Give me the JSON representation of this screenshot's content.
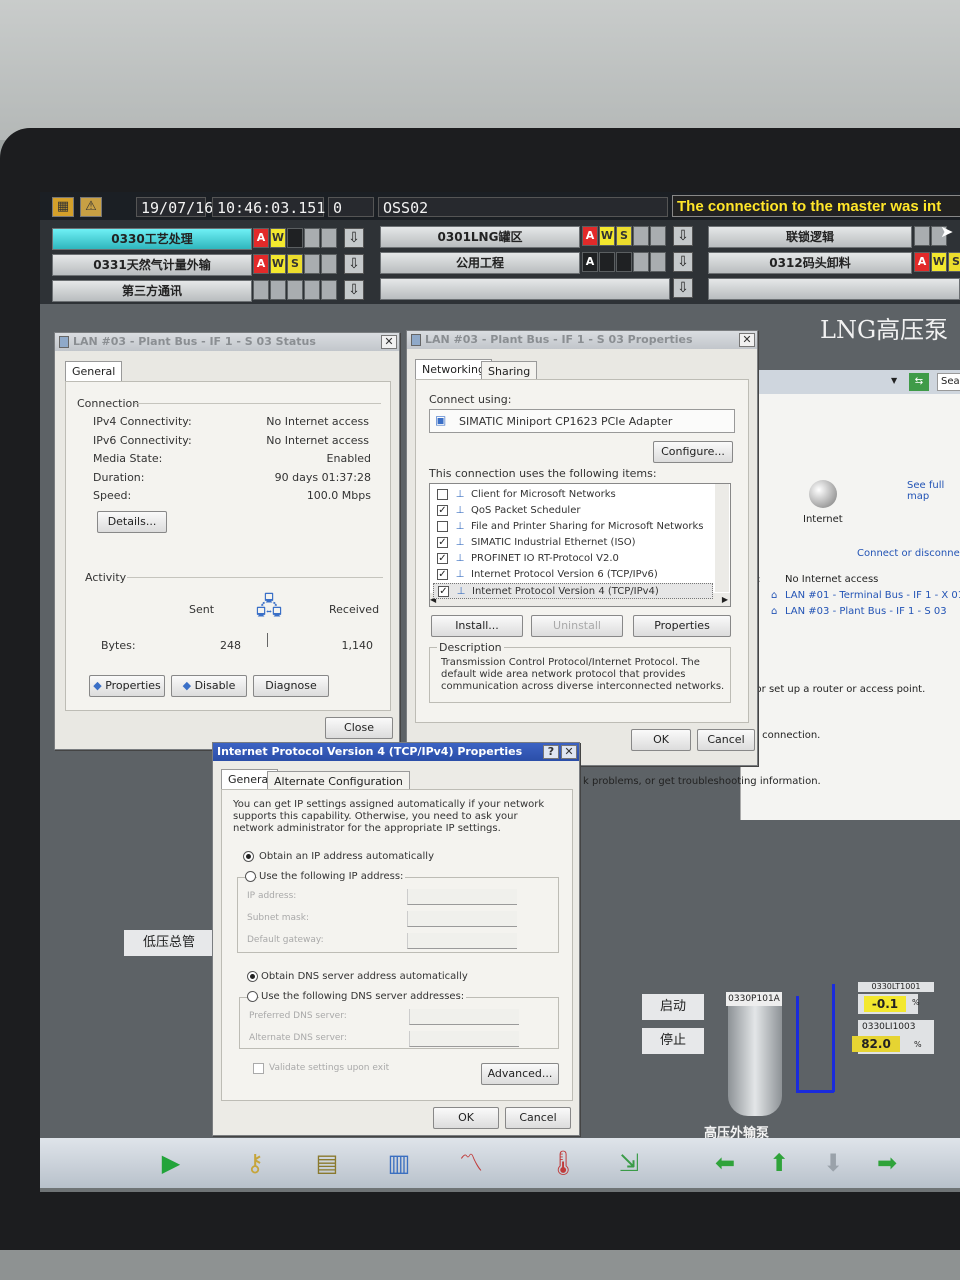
{
  "topbar": {
    "date": "19/07/16",
    "time": "10:46:03.151",
    "alarm_count": "0",
    "station": "OSS02",
    "message": "The connection to the master was int"
  },
  "areas": [
    {
      "label": "0330工艺处理",
      "flags": [
        "A",
        "W",
        "",
        ""
      ]
    },
    {
      "label": "0301LNG罐区",
      "flags": [
        "A",
        "W",
        "S",
        ""
      ]
    },
    {
      "label": "联锁逻辑",
      "flags": [
        "",
        "",
        ""
      ]
    },
    {
      "label": "0331天然气计量外输",
      "flags": [
        "A",
        "W",
        "S",
        ""
      ]
    },
    {
      "label": "公用工程",
      "flags": [
        "A",
        "",
        "",
        ""
      ]
    },
    {
      "label": "0312码头卸料",
      "flags": [
        "A",
        "W",
        "S"
      ]
    },
    {
      "label": "第三方通讯",
      "flags": [
        "",
        "",
        "",
        ""
      ]
    }
  ],
  "background": {
    "heading": "LNG高压泵",
    "search": "Sea",
    "see_full_map": "See full map",
    "internet_label": "Internet",
    "connect_link": "Connect or disconnect",
    "access_type_key": "e:",
    "access_type_value": "No Internet access",
    "connections_key": "s:",
    "conn1": "LAN #01 - Terminal Bus - IF 1 - X 01",
    "conn2": "LAN #03 - Plant Bus - IF 1 - S 03",
    "text_router": "; or set up a router or access point.",
    "text_network": "rk connection.",
    "text_problems": "k problems, or get troubleshooting information.",
    "low_pressure_label": "低压总管",
    "start_button": "启动",
    "stop_button": "停止",
    "pump_tag": "0330P101A",
    "pump_name": "高压外输泵",
    "level_tag1": "0330LT1001",
    "level_value1": "-0.1",
    "level_tag2": "0330LI1003",
    "level_value2": "82.0",
    "unit": "%"
  },
  "status_window": {
    "title": "LAN #03 - Plant Bus - IF 1 - S 03 Status",
    "tab": "General",
    "connection_header": "Connection",
    "rows": [
      {
        "key": "IPv4 Connectivity:",
        "value": "No Internet access"
      },
      {
        "key": "IPv6 Connectivity:",
        "value": "No Internet access"
      },
      {
        "key": "Media State:",
        "value": "Enabled"
      },
      {
        "key": "Duration:",
        "value": "90 days 01:37:28"
      },
      {
        "key": "Speed:",
        "value": "100.0 Mbps"
      }
    ],
    "details_button": "Details...",
    "activity_header": "Activity",
    "sent_label": "Sent",
    "received_label": "Received",
    "bytes_label": "Bytes:",
    "bytes_sent": "248",
    "bytes_received": "1,140",
    "properties_button": "Properties",
    "disable_button": "Disable",
    "diagnose_button": "Diagnose",
    "close_button": "Close"
  },
  "properties_window": {
    "title": "LAN #03 - Plant Bus - IF 1 - S 03 Properties",
    "tabs": [
      "Networking",
      "Sharing"
    ],
    "connect_using_label": "Connect using:",
    "adapter": "SIMATIC Miniport CP1623 PCIe Adapter",
    "configure_button": "Configure...",
    "items_label": "This connection uses the following items:",
    "items": [
      {
        "label": "Client for Microsoft Networks",
        "checked": false
      },
      {
        "label": "QoS Packet Scheduler",
        "checked": true
      },
      {
        "label": "File and Printer Sharing for Microsoft Networks",
        "checked": false
      },
      {
        "label": "SIMATIC Industrial Ethernet (ISO)",
        "checked": true
      },
      {
        "label": "PROFINET IO RT-Protocol V2.0",
        "checked": true
      },
      {
        "label": "Internet Protocol Version 6 (TCP/IPv6)",
        "checked": true
      },
      {
        "label": "Internet Protocol Version 4 (TCP/IPv4)",
        "checked": true
      }
    ],
    "install_button": "Install...",
    "uninstall_button": "Uninstall",
    "properties_button": "Properties",
    "description_header": "Description",
    "description": "Transmission Control Protocol/Internet Protocol. The default wide area network protocol that provides communication across diverse interconnected networks.",
    "ok_button": "OK",
    "cancel_button": "Cancel"
  },
  "ipv4_window": {
    "title": "Internet Protocol Version 4 (TCP/IPv4) Properties",
    "help": "?",
    "tabs": [
      "General",
      "Alternate Configuration"
    ],
    "intro": "You can get IP settings assigned automatically if your network supports this capability. Otherwise, you need to ask your network administrator for the appropriate IP settings.",
    "obtain_ip_auto": "Obtain an IP address automatically",
    "use_following_ip": "Use the following IP address:",
    "ip_address": "IP address:",
    "subnet_mask": "Subnet mask:",
    "default_gateway": "Default gateway:",
    "obtain_dns_auto": "Obtain DNS server address automatically",
    "use_following_dns": "Use the following DNS server addresses:",
    "preferred_dns": "Preferred DNS server:",
    "alternate_dns": "Alternate DNS server:",
    "validate": "Validate settings upon exit",
    "advanced_button": "Advanced...",
    "ok_button": "OK",
    "cancel_button": "Cancel"
  },
  "toolbar_icons": [
    "play-icon",
    "keys-icon",
    "notepad-icon",
    "report-icon",
    "trend-icon",
    "thermometer-icon",
    "export-icon",
    "arrow-left-icon",
    "arrow-up-icon",
    "arrow-down-icon",
    "arrow-right-icon"
  ]
}
